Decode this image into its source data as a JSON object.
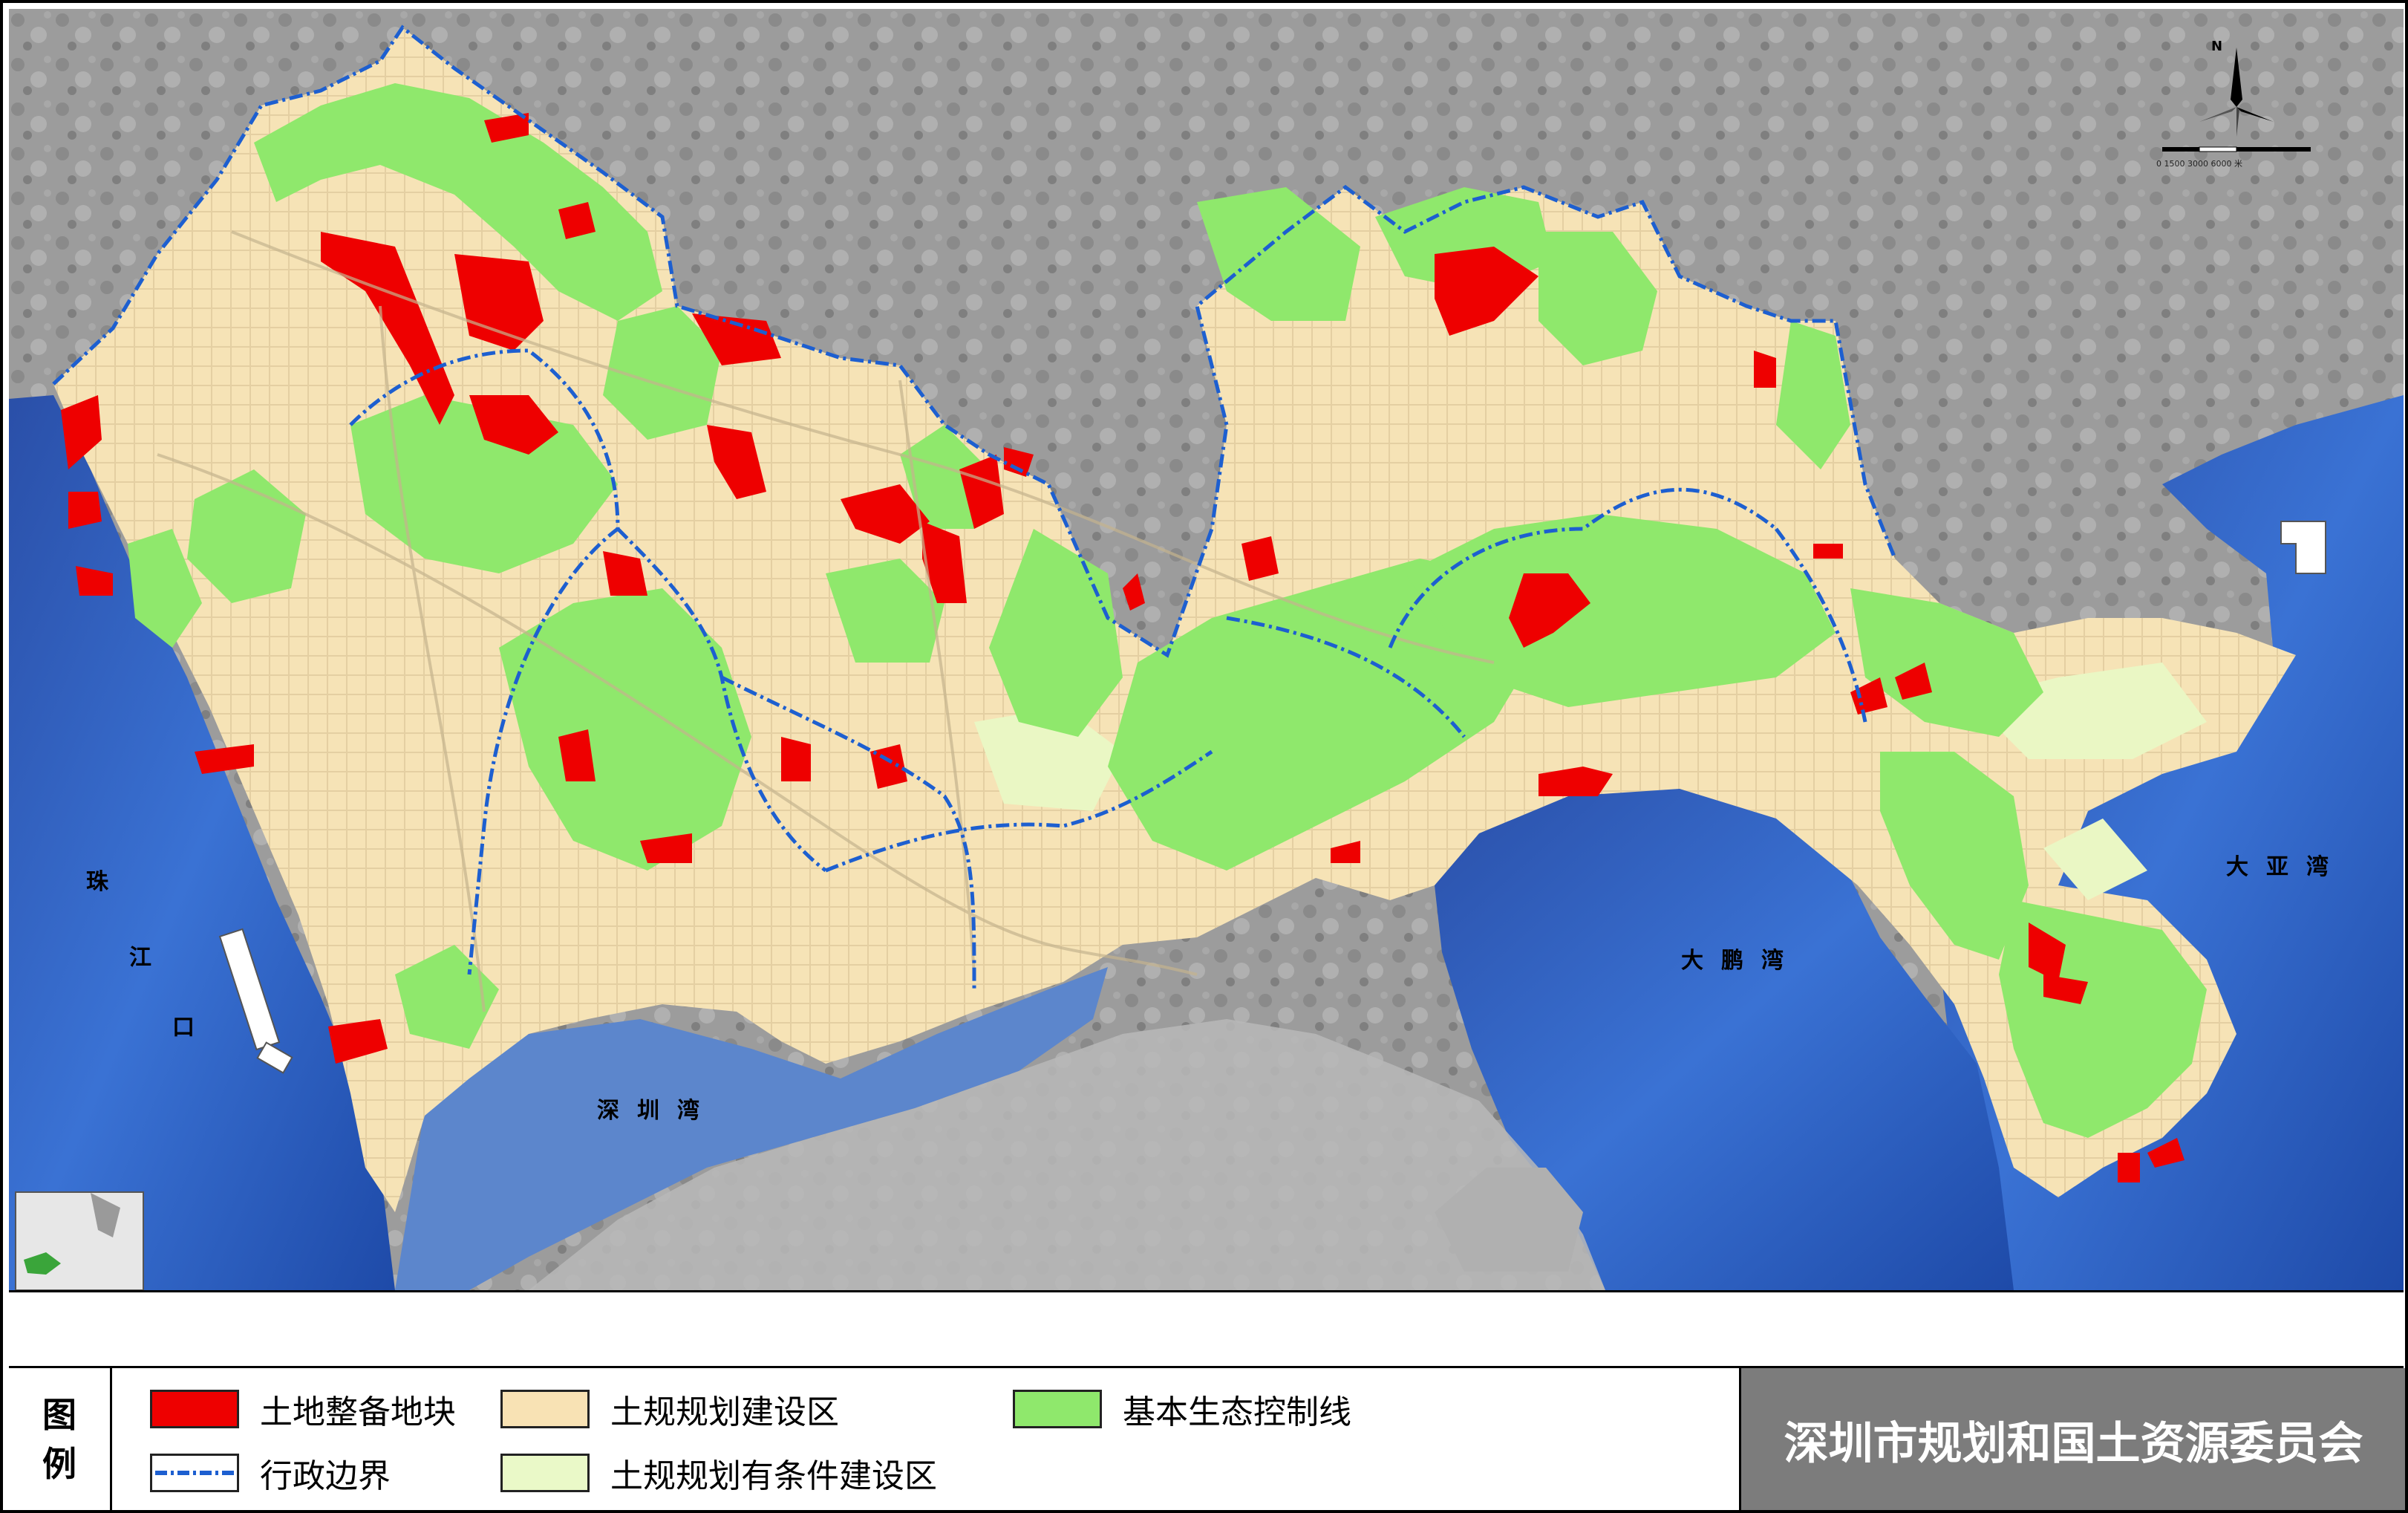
{
  "map": {
    "water_labels": {
      "pearl_river": [
        "珠",
        "江",
        "口"
      ],
      "shenzhen_bay": "深圳湾",
      "dapeng_bay": "大鹏湾",
      "daya_bay": "大亚湾"
    },
    "compass_letter": "N",
    "scale_text": "0    1500   3000         6000 米",
    "colors": {
      "sea": "#2e63c2",
      "terrain": "#9a9a9a",
      "construction": "#f6e3b6",
      "conditional": "#eaf7c4",
      "ecological": "#8fe86c",
      "plot": "#ee0000",
      "boundary": "#1d5fd0"
    }
  },
  "legend": {
    "title_chars": [
      "图",
      "例"
    ],
    "items": [
      {
        "key": "plot",
        "label": "土地整备地块",
        "type": "fill",
        "color": "#ee0000"
      },
      {
        "key": "construction",
        "label": "土规规划建设区",
        "type": "fill",
        "color": "#f8e2b4"
      },
      {
        "key": "ecological",
        "label": "基本生态控制线",
        "type": "fill",
        "color": "#8fe86c"
      },
      {
        "key": "boundary",
        "label": "行政边界",
        "type": "line",
        "color": "#1d5fd0"
      },
      {
        "key": "conditional",
        "label": "土规规划有条件建设区",
        "type": "fill",
        "color": "#eaf9c8"
      }
    ]
  },
  "agency": "深圳市规划和国土资源委员会"
}
